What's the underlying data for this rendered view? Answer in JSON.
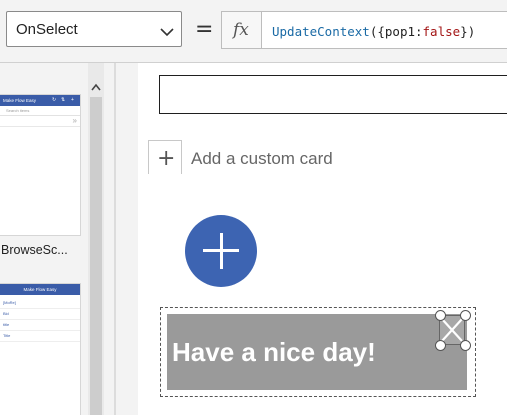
{
  "formula_bar": {
    "property": "OnSelect",
    "equals": "=",
    "fx": "fx",
    "formula_fn": "UpdateContext",
    "formula_open": "({pop1:",
    "formula_kw": "false",
    "formula_close": "})"
  },
  "screens_panel": {
    "thumb1": {
      "header_title": "Make Flow Easy",
      "header_icons": [
        "↻",
        "⇅",
        "+"
      ],
      "search_placeholder": "Search items",
      "chevron": "»"
    },
    "screen_label": "BrowseSc...",
    "thumb2": {
      "header_title": "Make Flow Easy",
      "items": [
        "[MoRe]",
        "Bld",
        "title",
        "Title"
      ]
    }
  },
  "canvas": {
    "add_card_glyph": "+",
    "add_card_label": "Add a custom card",
    "banner_text": "Have a nice day!"
  },
  "colors": {
    "accent_blue": "#3d64b2",
    "banner_gray": "#9a9a9a",
    "formula_function": "#1a6aa5",
    "formula_keyword": "#a31515"
  },
  "icons": {
    "dropdown": "chevron-down-icon",
    "scroll_up": "chevron-up-icon",
    "fab": "plus-icon",
    "close": "close-icon"
  }
}
